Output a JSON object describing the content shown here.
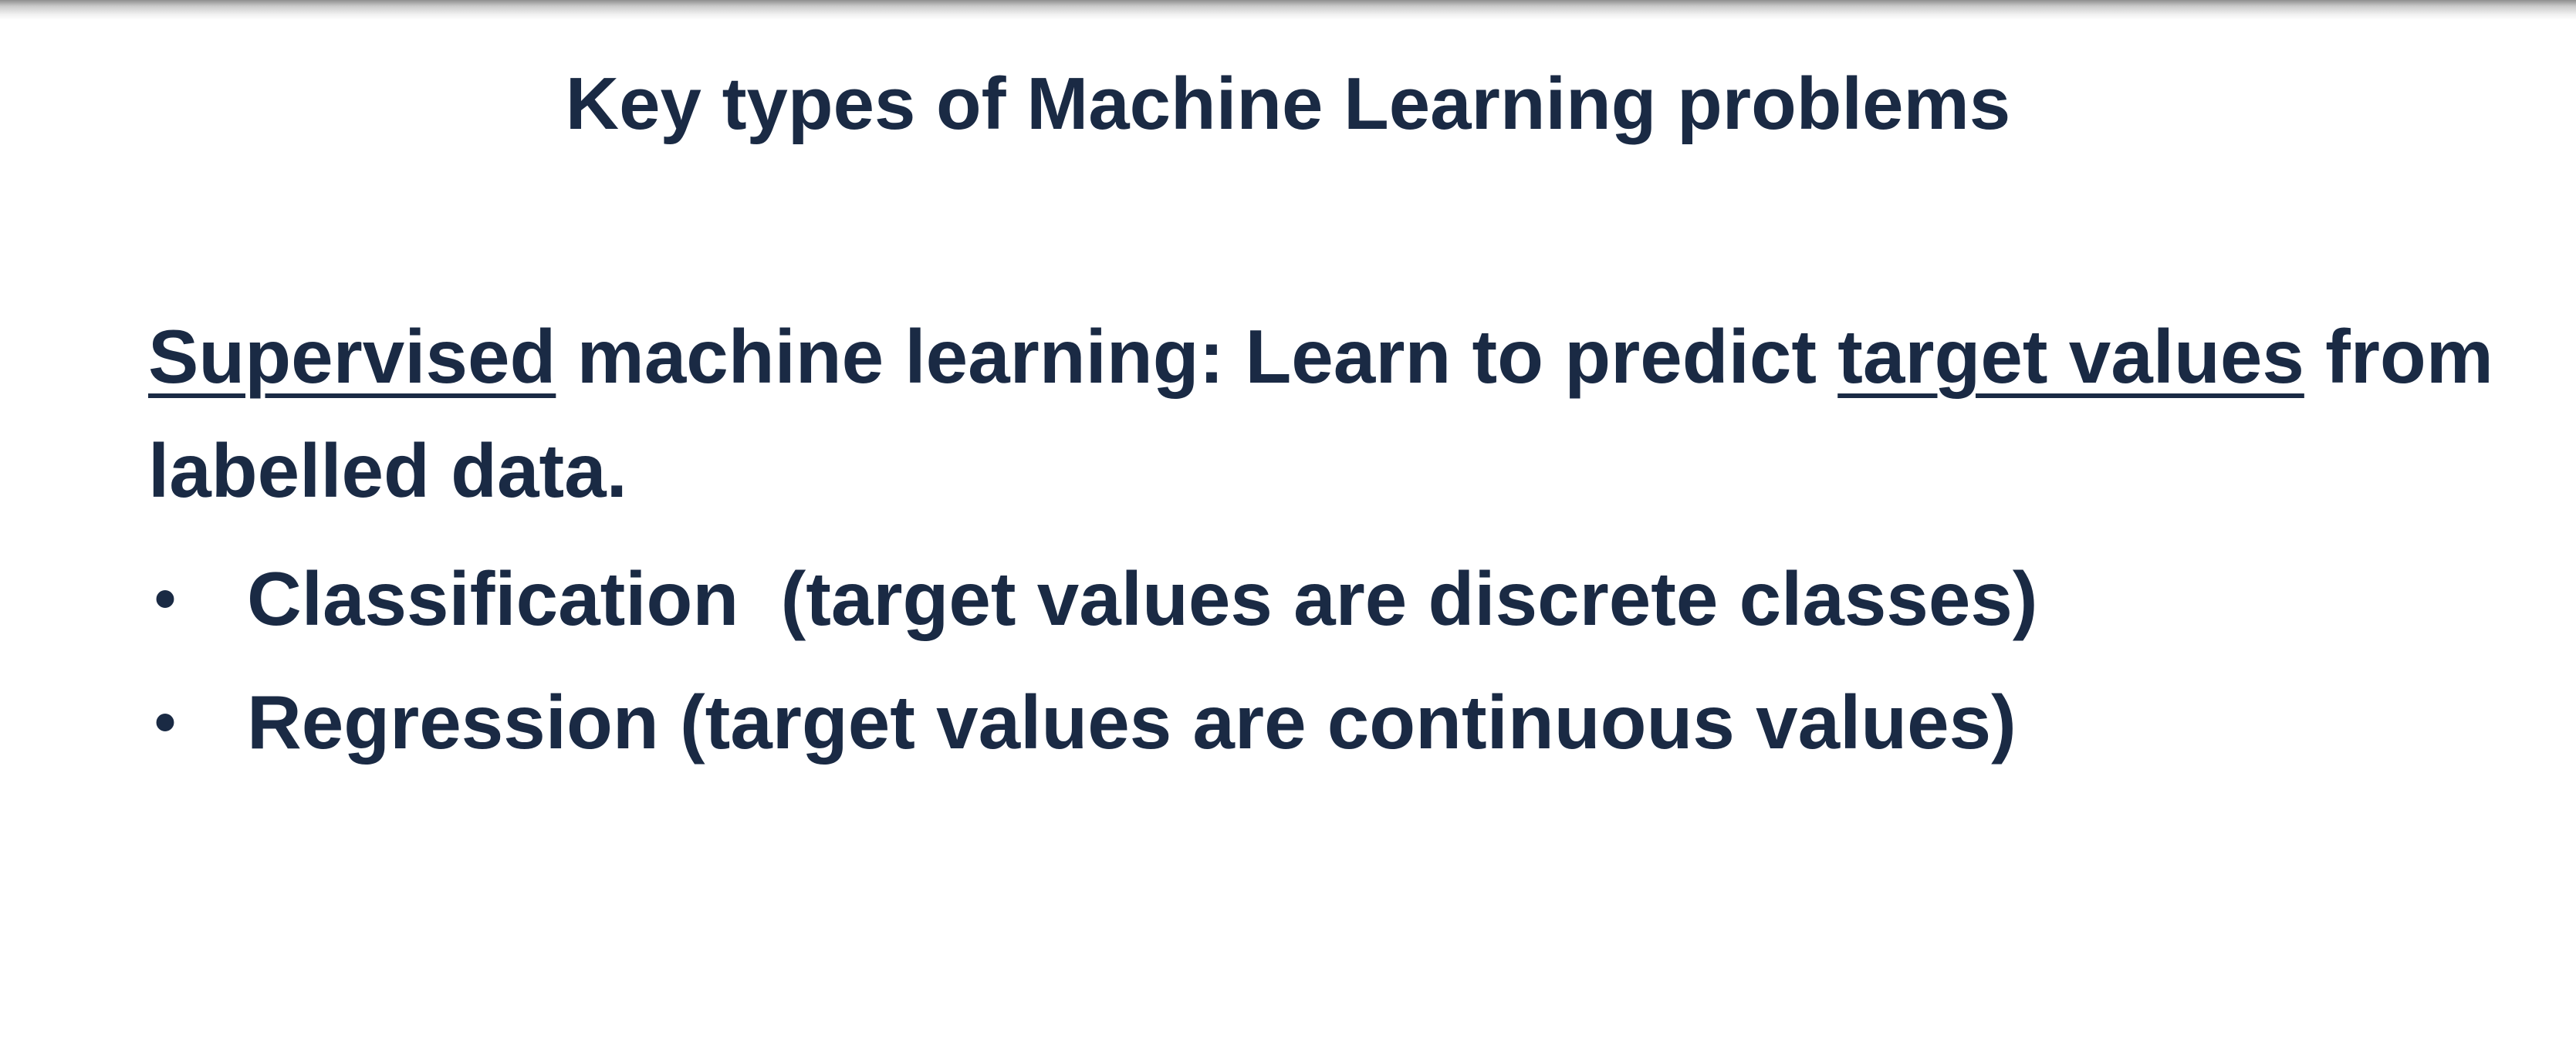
{
  "slide": {
    "title": "Key types of Machine Learning problems",
    "paragraph": {
      "term_supervised": "Supervised",
      "text_middle": " machine learning: Learn to predict ",
      "term_target_values": "target values",
      "text_end": " from labelled data."
    },
    "bullets": [
      {
        "marker": "•",
        "text": "Classification  (target values are discrete classes)"
      },
      {
        "marker": "•",
        "text": "Regression (target values are continuous values)"
      }
    ]
  }
}
